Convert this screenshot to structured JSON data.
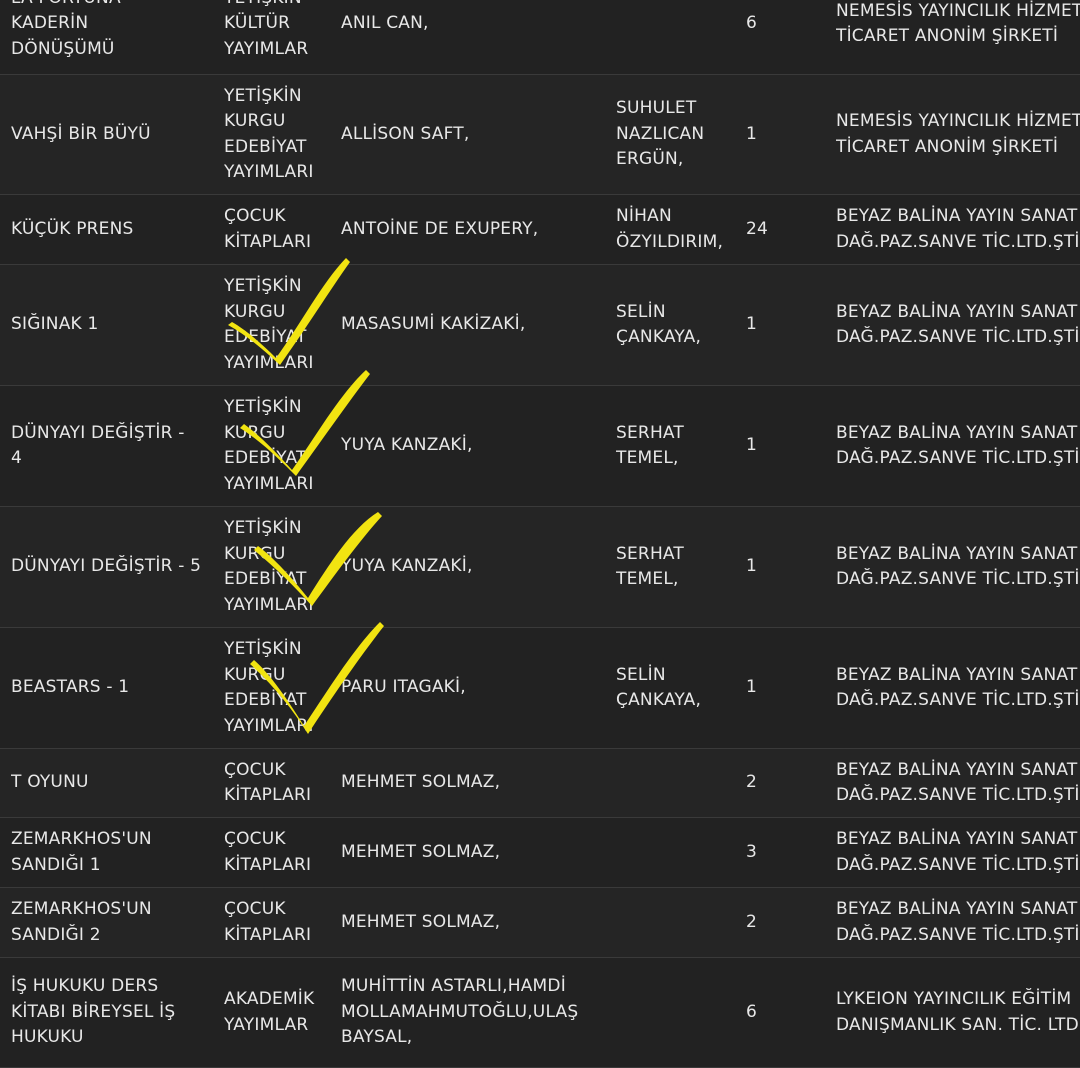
{
  "rows": [
    {
      "title": "LA FORTUNA\nKADERİN\nDÖNÜŞÜMÜ",
      "category": "YETİŞKİN\nKÜLTÜR\nYAYIMLAR",
      "author": "ANIL CAN,",
      "translator": "",
      "count": "6",
      "publisher": "NEMESİS YAYINCILIK HİZMET\nTİCARET ANONİM ŞİRKETİ"
    },
    {
      "title": "VAHŞİ BİR BÜYÜ",
      "category": "YETİŞKİN\nKURGU\nEDEBİYAT\nYAYIMLARI",
      "author": "ALLİSON SAFT,",
      "translator": "SUHULET\nNAZLICAN\nERGÜN,",
      "count": "1",
      "publisher": "NEMESİS YAYINCILIK HİZMET\nTİCARET ANONİM ŞİRKETİ"
    },
    {
      "title": "KÜÇÜK PRENS",
      "category": "ÇOCUK\nKİTAPLARI",
      "author": "ANTOİNE DE EXUPERY,",
      "translator": "NİHAN\nÖZYILDIRIM,",
      "count": "24",
      "publisher": "BEYAZ BALİNA YAYIN SANAT\nDAĞ.PAZ.SANVE TİC.LTD.ŞTİ."
    },
    {
      "title": "SIĞINAK 1",
      "category": "YETİŞKİN\nKURGU\nEDEBİYAT\nYAYIMLARI",
      "author": "MASASUMİ KAKİZAKİ,",
      "translator": "SELİN\nÇANKAYA,",
      "count": "1",
      "publisher": "BEYAZ BALİNA YAYIN SANAT\nDAĞ.PAZ.SANVE TİC.LTD.ŞTİ."
    },
    {
      "title": "DÜNYAYI DEĞİŞTİR -\n4",
      "category": "YETİŞKİN\nKURGU\nEDEBİYAT\nYAYIMLARI",
      "author": "YUYA KANZAKİ,",
      "translator": "SERHAT\nTEMEL,",
      "count": "1",
      "publisher": "BEYAZ BALİNA YAYIN SANAT\nDAĞ.PAZ.SANVE TİC.LTD.ŞTİ."
    },
    {
      "title": "DÜNYAYI DEĞİŞTİR - 5",
      "category": "YETİŞKİN\nKURGU\nEDEBİYAT\nYAYIMLARI",
      "author": "YUYA KANZAKİ,",
      "translator": "SERHAT\nTEMEL,",
      "count": "1",
      "publisher": "BEYAZ BALİNA YAYIN SANAT\nDAĞ.PAZ.SANVE TİC.LTD.ŞTİ."
    },
    {
      "title": "BEASTARS - 1",
      "category": "YETİŞKİN\nKURGU\nEDEBİYAT\nYAYIMLARI",
      "author": "PARU ITAGAKİ,",
      "translator": "SELİN\nÇANKAYA,",
      "count": "1",
      "publisher": "BEYAZ BALİNA YAYIN SANAT\nDAĞ.PAZ.SANVE TİC.LTD.ŞTİ."
    },
    {
      "title": "T OYUNU",
      "category": "ÇOCUK\nKİTAPLARI",
      "author": "MEHMET SOLMAZ,",
      "translator": "",
      "count": "2",
      "publisher": "BEYAZ BALİNA YAYIN SANAT\nDAĞ.PAZ.SANVE TİC.LTD.ŞTİ."
    },
    {
      "title": "ZEMARKHOS'UN\nSANDIĞI 1",
      "category": "ÇOCUK\nKİTAPLARI",
      "author": "MEHMET SOLMAZ,",
      "translator": "",
      "count": "3",
      "publisher": "BEYAZ BALİNA YAYIN SANAT\nDAĞ.PAZ.SANVE TİC.LTD.ŞTİ."
    },
    {
      "title": "ZEMARKHOS'UN\nSANDIĞI 2",
      "category": "ÇOCUK\nKİTAPLARI",
      "author": "MEHMET SOLMAZ,",
      "translator": "",
      "count": "2",
      "publisher": "BEYAZ BALİNA YAYIN SANAT\nDAĞ.PAZ.SANVE TİC.LTD.ŞTİ."
    },
    {
      "title": "İŞ HUKUKU DERS\nKİTABI BİREYSEL İŞ\nHUKUKU",
      "category": "AKADEMİK\nYAYIMLAR",
      "author": "MUHİTTİN ASTARLI,HAMDİ\nMOLLAMAHMUTOĞLU,ULAŞ\nBAYSAL,",
      "translator": "",
      "count": "6",
      "publisher": "LYKEION YAYINCILIK EĞİTİM\nDANIŞMANLIK SAN. TİC. LTD."
    }
  ],
  "colors": {
    "background": "#222222",
    "text": "#e8e8e8",
    "divider": "#3a3a3a",
    "check_mark": "#f2e411"
  },
  "annotations": {
    "check_icon": "handwritten-check-mark-icon"
  }
}
